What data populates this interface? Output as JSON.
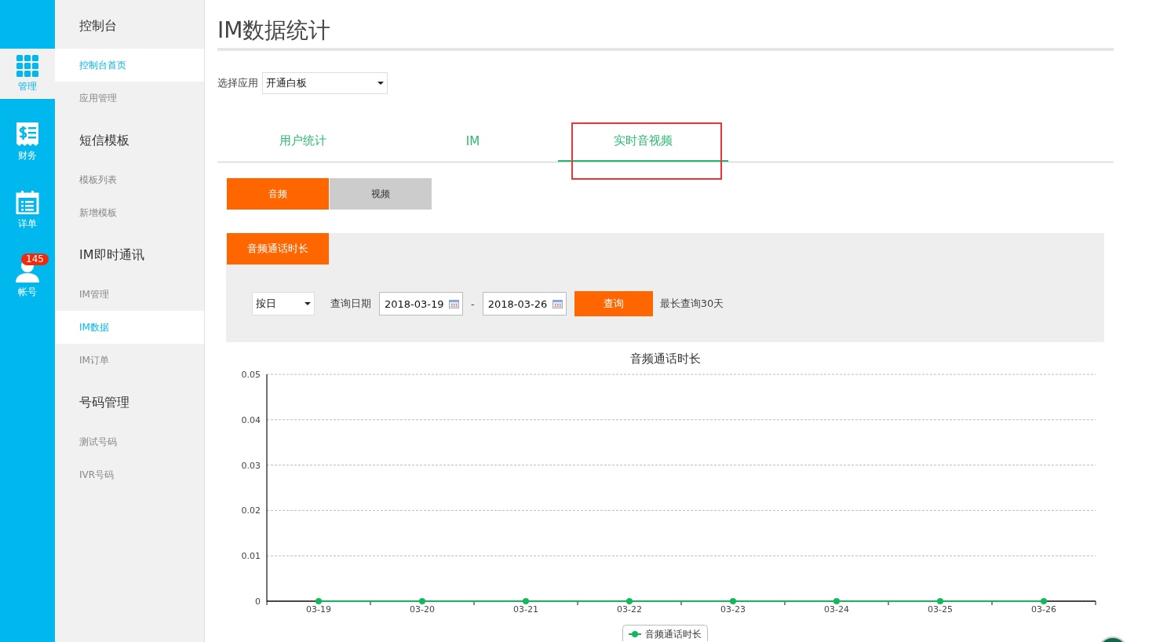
{
  "rail": {
    "items": [
      {
        "label": "管理",
        "selected": true
      },
      {
        "label": "财务",
        "selected": false
      },
      {
        "label": "详单",
        "selected": false
      },
      {
        "label": "帐号",
        "selected": false,
        "badge": "145"
      }
    ]
  },
  "sidebar": {
    "groups": [
      {
        "title": "控制台",
        "items": [
          {
            "label": "控制台首页",
            "selected": true
          },
          {
            "label": "应用管理",
            "selected": false
          }
        ]
      },
      {
        "title": "短信模板",
        "items": [
          {
            "label": "模板列表",
            "selected": false
          },
          {
            "label": "新增模板",
            "selected": false
          }
        ]
      },
      {
        "title": "IM即时通讯",
        "items": [
          {
            "label": "IM管理",
            "selected": false
          },
          {
            "label": "IM数据",
            "selected": true
          },
          {
            "label": "IM订单",
            "selected": false
          }
        ]
      },
      {
        "title": "号码管理",
        "items": [
          {
            "label": "测试号码",
            "selected": false
          },
          {
            "label": "IVR号码",
            "selected": false
          }
        ]
      }
    ]
  },
  "page": {
    "title": "IM数据统计"
  },
  "app_select": {
    "label": "选择应用",
    "value": "开通白板"
  },
  "tabs": [
    {
      "label": "用户统计",
      "selected": false
    },
    {
      "label": "IM",
      "selected": false
    },
    {
      "label": "实时音视频",
      "selected": true
    }
  ],
  "media_tabs": [
    {
      "label": "音频",
      "selected": true
    },
    {
      "label": "视频",
      "selected": false
    }
  ],
  "panel": {
    "tab": "音频通话时长",
    "period": "按日",
    "date_label": "查询日期",
    "start_date": "2018-03-19",
    "separator": "-",
    "end_date": "2018-03-26",
    "query_button": "查询",
    "note": "最长查询30天",
    "chart_data": {
      "type": "line",
      "title": "音频通话时长",
      "categories": [
        "03-19",
        "03-20",
        "03-21",
        "03-22",
        "03-23",
        "03-24",
        "03-25",
        "03-26"
      ],
      "series": [
        {
          "name": "音频通话时长",
          "color": "#14b85a",
          "marker": "circle",
          "values": [
            0,
            0,
            0,
            0,
            0,
            0,
            0,
            0
          ]
        }
      ],
      "grid": true,
      "ylim": [
        0,
        0.05
      ],
      "yticks": [
        {
          "value": 0,
          "label": "0"
        },
        {
          "value": 0.01,
          "label": "0.01"
        },
        {
          "value": 0.02,
          "label": "0.02"
        },
        {
          "value": 0.03,
          "label": "0.03"
        },
        {
          "value": 0.04,
          "label": "0.04"
        },
        {
          "value": 0.05,
          "label": "0.05"
        }
      ]
    }
  }
}
